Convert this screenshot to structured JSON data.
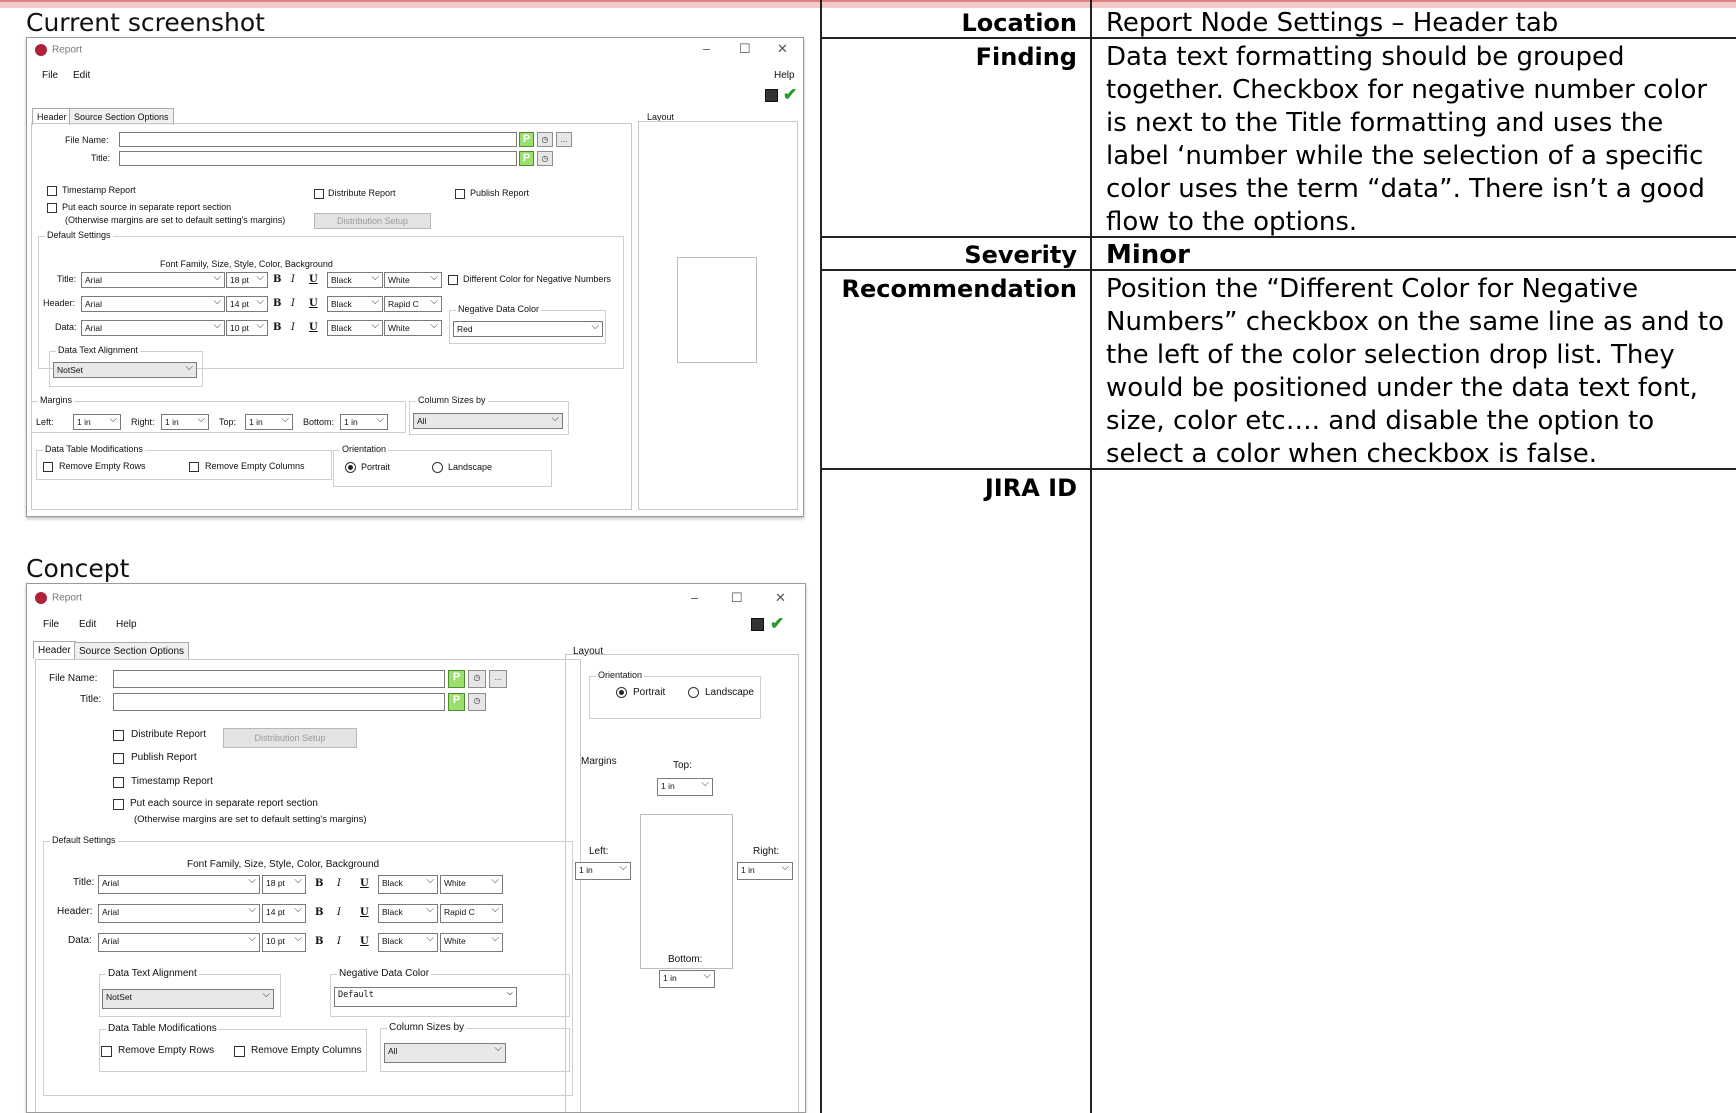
{
  "panels": {
    "current_heading": "Current screenshot",
    "concept_heading": "Concept"
  },
  "window": {
    "title": "Report",
    "menu_file": "File",
    "menu_edit": "Edit",
    "menu_help": "Help",
    "tab_header": "Header",
    "tab_source": "Source Section Options",
    "layout_label": "Layout",
    "file_name_label": "File Name:",
    "title_label": "Title:",
    "p_btn": "P",
    "clock_btn": "◷",
    "browse_btn": "...",
    "timestamp_report": "Timestamp Report",
    "distribute_report": "Distribute Report",
    "publish_report": "Publish Report",
    "separate_section": "Put each source in separate report section",
    "separate_section_note": "(Otherwise margins are set to default setting's margins)",
    "distribution_setup": "Distribution Setup",
    "default_settings": "Default Settings",
    "font_hint": "Font Family, Size, Style, Color, Background",
    "row_title": "Title:",
    "row_header": "Header:",
    "row_data": "Data:",
    "font_arial": "Arial",
    "size_title": "18 pt",
    "size_header": "14 pt",
    "size_data": "10 pt",
    "bold": "B",
    "italic": "I",
    "underline": "U",
    "color_black": "Black",
    "bg_white": "White",
    "bg_rapid": "Rapid C",
    "neg_numbers": "Different Color for Negative Numbers",
    "neg_data_color": "Negative Data Color",
    "neg_color_current": "Red",
    "neg_color_concept": "Default",
    "data_text_alignment": "Data Text Alignment",
    "alignment_value": "NotSet",
    "margins": "Margins",
    "left": "Left:",
    "right": "Right:",
    "top": "Top:",
    "bottom": "Bottom:",
    "margin_value": "1 in",
    "column_sizes": "Column Sizes by",
    "column_sizes_concept": "Column Sizes by",
    "column_sizes_value": "All",
    "data_table_mods": "Data Table Modifications",
    "remove_empty_rows": "Remove Empty Rows",
    "remove_empty_cols": "Remove Empty Columns",
    "orientation": "Orientation",
    "portrait": "Portrait",
    "landscape": "Landscape"
  },
  "finding": {
    "location_label": "Location",
    "location_value": "Report Node Settings – Header tab",
    "finding_label": "Finding",
    "finding_value": "Data text formatting should be grouped together. Checkbox for negative number color is next to the Title formatting and uses the label ‘number while the selection of a specific color uses the term “data”. There isn’t a good flow to the options.",
    "severity_label": "Severity",
    "severity_value": "Minor",
    "recommendation_label": "Recommendation",
    "recommendation_value": "Position the “Different Color for Negative Numbers” checkbox on the same line as and to the left of the color selection drop list. They would be positioned under the data text font, size, color etc…. and disable the option to select a color when checkbox is false.",
    "jira_label": "JIRA ID",
    "jira_value": ""
  }
}
